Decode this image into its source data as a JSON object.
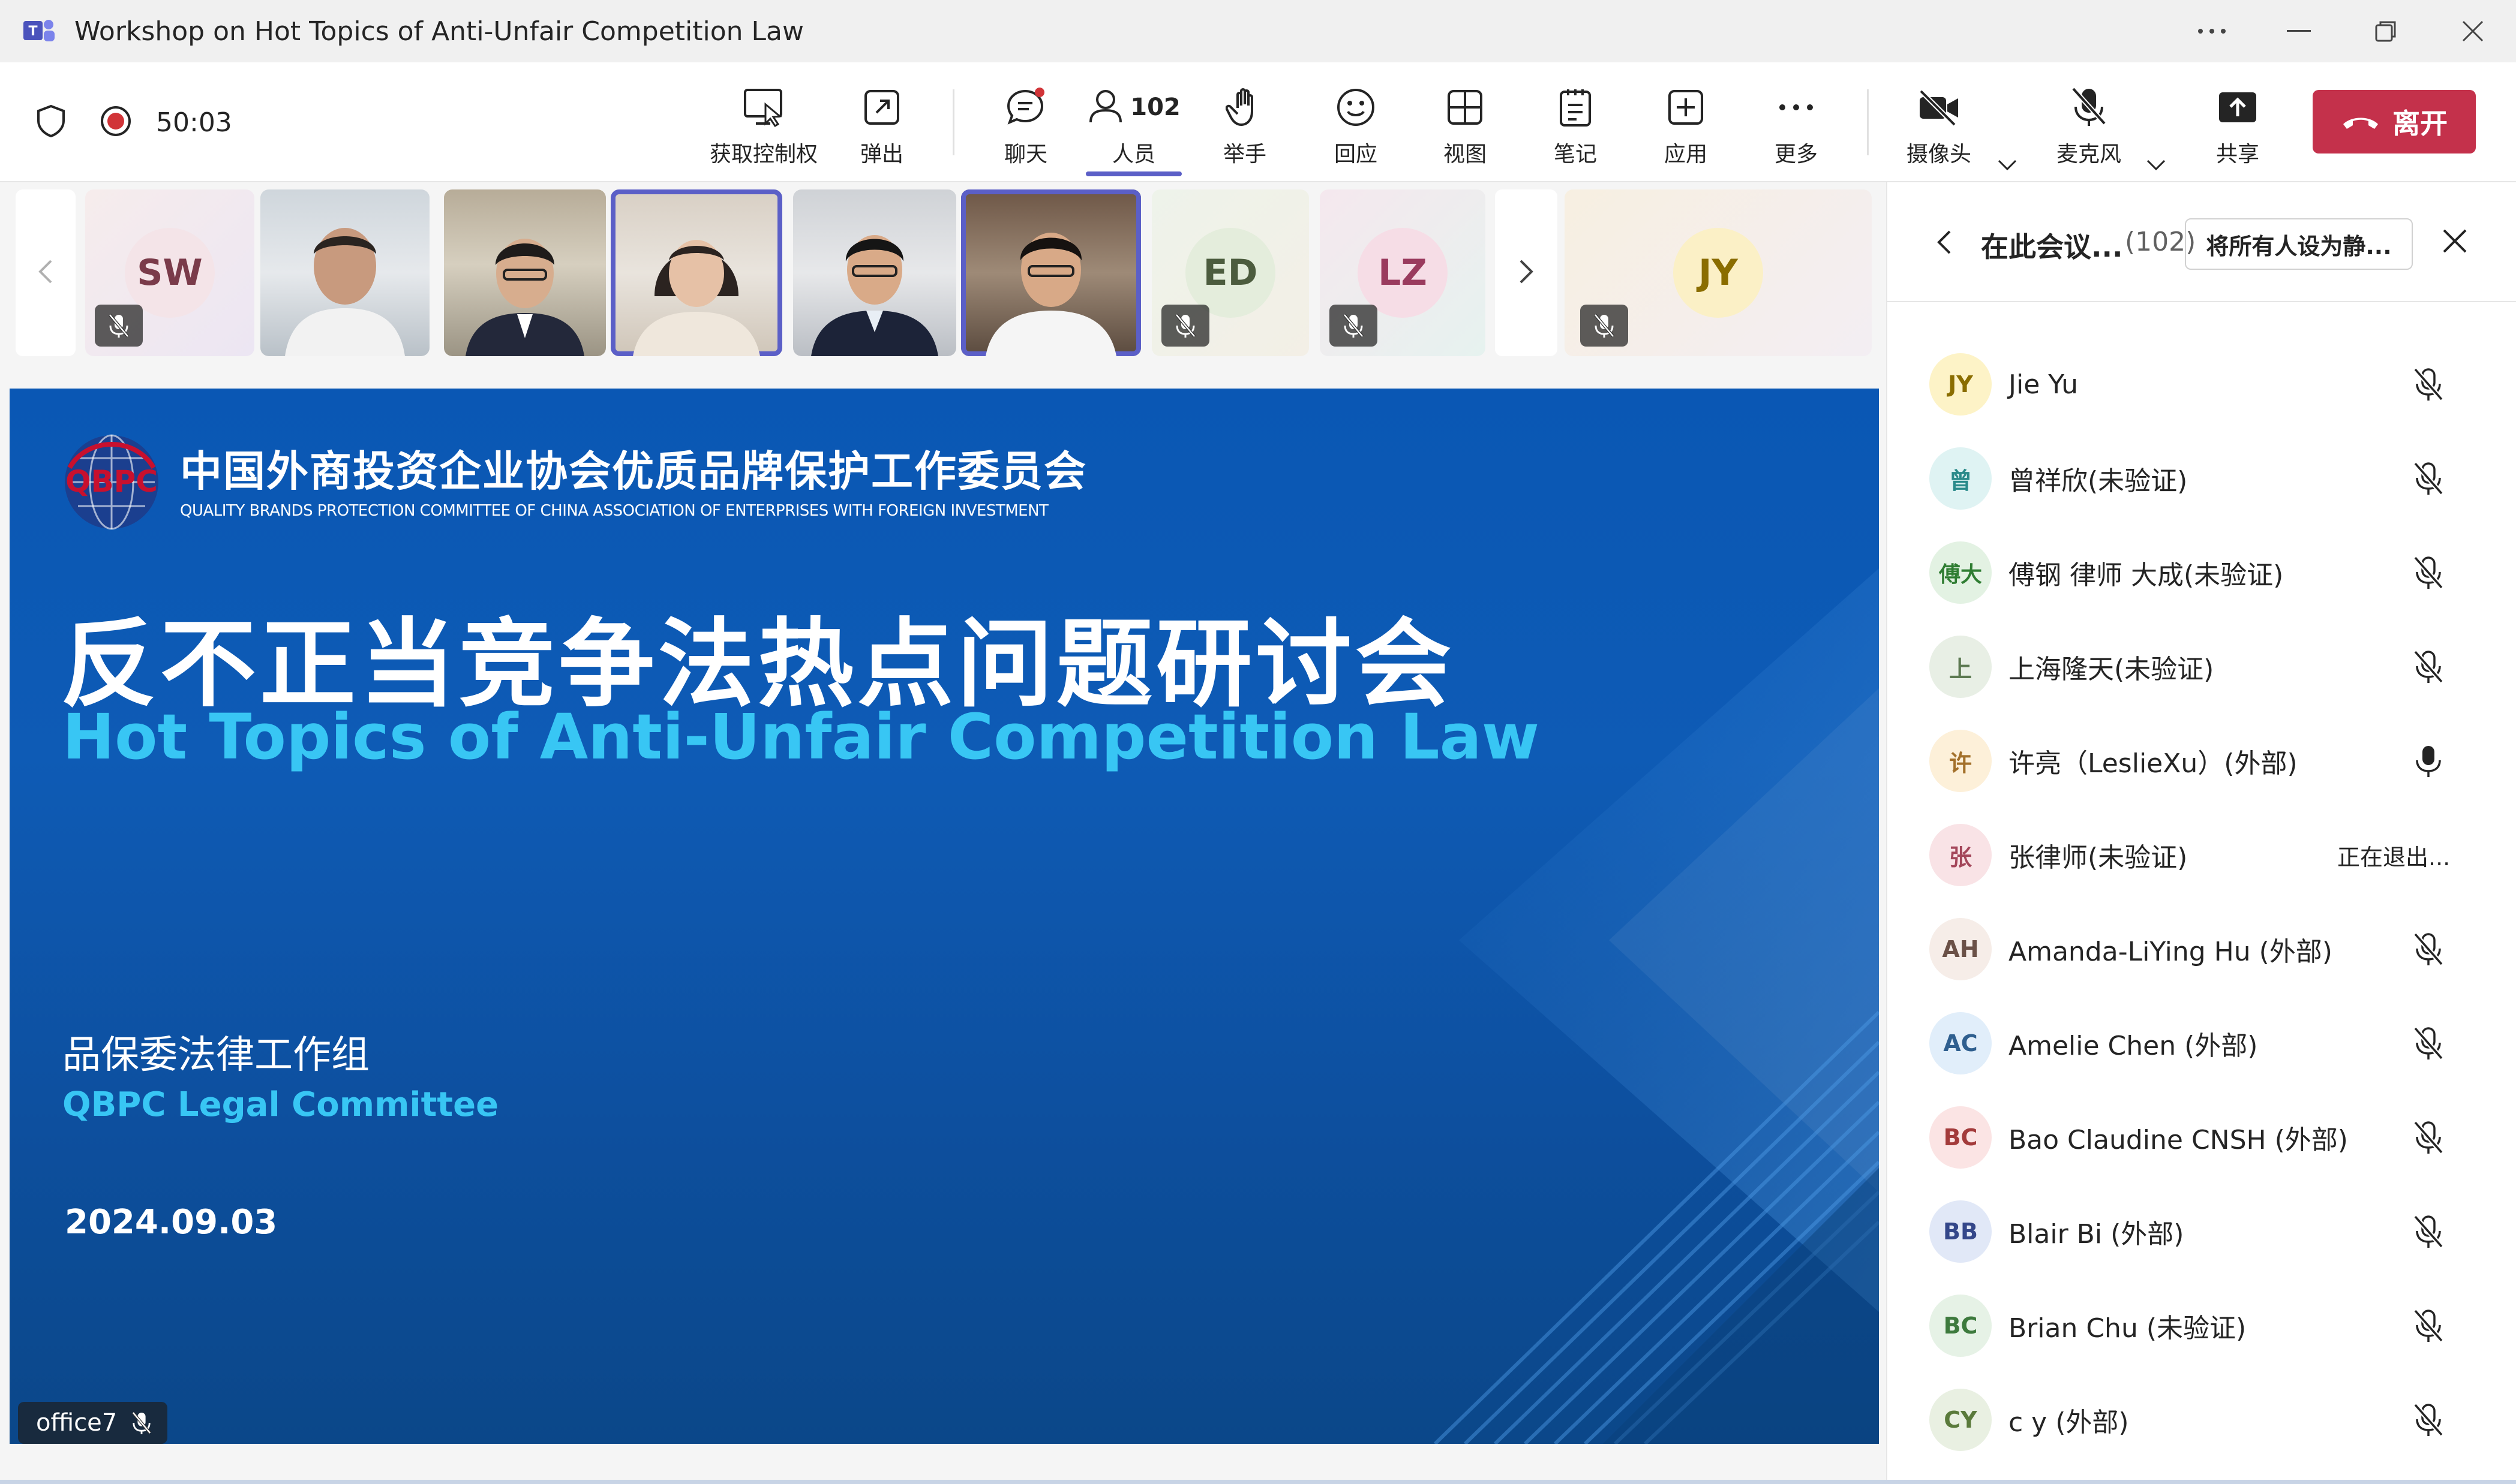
{
  "window": {
    "title": "Workshop on Hot Topics of Anti-Unfair Competition Law",
    "app_icon": "teams-icon"
  },
  "status": {
    "timer": "50:03",
    "recording": true
  },
  "toolbar": {
    "take_control": "获取控制权",
    "pop_out": "弹出",
    "chat": "聊天",
    "people": "人员",
    "people_count": "102",
    "raise_hand": "举手",
    "react": "回应",
    "view": "视图",
    "notes": "笔记",
    "apps": "应用",
    "more": "更多",
    "camera": "摄像头",
    "mic": "麦克风",
    "share": "共享",
    "leave": "离开"
  },
  "strip": {
    "tiles": [
      {
        "initials": "SW",
        "muted": true
      },
      {
        "initials": "ED",
        "muted": true
      },
      {
        "initials": "LZ",
        "muted": true
      },
      {
        "initials": "JY",
        "muted": true
      }
    ]
  },
  "slide": {
    "org_logo_text": "QBPC",
    "org_cn": "中国外商投资企业协会优质品牌保护工作委员会",
    "org_en": "QUALITY BRANDS PROTECTION COMMITTEE OF CHINA ASSOCIATION OF ENTERPRISES WITH FOREIGN INVESTMENT",
    "title_cn": "反不正当竞争法热点问题研讨会",
    "title_en": "Hot Topics of Anti-Unfair Competition Law",
    "dept_cn": "品保委法律工作组",
    "dept_en": "QBPC Legal Committee",
    "date": "2024.09.03",
    "presenter": "office7"
  },
  "panel": {
    "title": "在此会议...",
    "count": "(102)",
    "mute_all": "将所有人设为静...",
    "participants": [
      {
        "initials": "JY",
        "name": "Jie Yu",
        "color": "#fdf3c7",
        "fg": "#8a6d00",
        "mic": "muted"
      },
      {
        "initials": "曾",
        "name": "曾祥欣(未验证)",
        "color": "#dff3f3",
        "fg": "#2a8a8a",
        "mic": "muted"
      },
      {
        "initials": "傅大",
        "name": "傅钢 律师 大成(未验证)",
        "color": "#e3f2e3",
        "fg": "#2f7d32",
        "mic": "muted"
      },
      {
        "initials": "上",
        "name": "上海隆天(未验证)",
        "color": "#e8efe5",
        "fg": "#5d7a52",
        "mic": "muted"
      },
      {
        "initials": "许",
        "name": "许亮（LeslieXu）(外部)",
        "color": "#fdf0d9",
        "fg": "#a3702a",
        "mic": "on"
      },
      {
        "initials": "张",
        "name": "张律师(未验证)",
        "color": "#f9e3e6",
        "fg": "#a4465a",
        "mic": "leaving",
        "status": "正在退出..."
      },
      {
        "initials": "AH",
        "name": "Amanda-LiYing Hu (外部)",
        "color": "#f6ede8",
        "fg": "#6b5147",
        "mic": "muted"
      },
      {
        "initials": "AC",
        "name": "Amelie Chen (外部)",
        "color": "#e1eefa",
        "fg": "#2f5f8f",
        "mic": "muted"
      },
      {
        "initials": "BC",
        "name": "Bao Claudine CNSH (外部)",
        "color": "#fbe4e4",
        "fg": "#a33b3b",
        "mic": "muted"
      },
      {
        "initials": "BB",
        "name": "Blair Bi (外部)",
        "color": "#e1e8f7",
        "fg": "#34478a",
        "mic": "muted"
      },
      {
        "initials": "BC",
        "name": "Brian Chu (未验证)",
        "color": "#e6f2e6",
        "fg": "#3d7a3d",
        "mic": "muted"
      },
      {
        "initials": "CY",
        "name": "c y (外部)",
        "color": "#e9f0e2",
        "fg": "#5a7a3b",
        "mic": "muted"
      }
    ]
  }
}
